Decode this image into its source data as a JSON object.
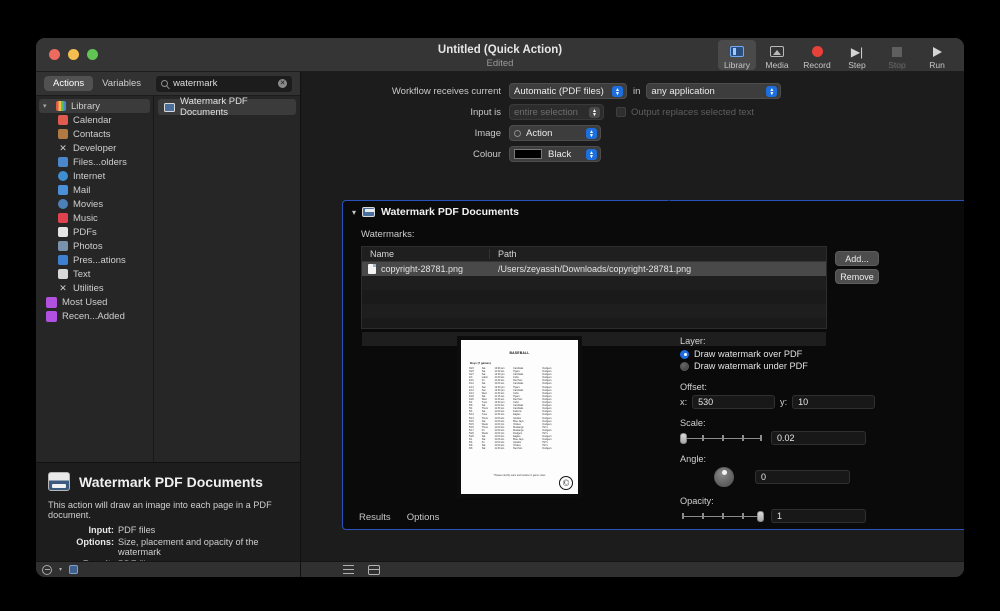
{
  "window": {
    "title": "Untitled (Quick Action)",
    "subtitle": "Edited"
  },
  "toolbar": {
    "items": [
      {
        "label": "Library",
        "icon": "library-icon",
        "active": true,
        "enabled": true
      },
      {
        "label": "Media",
        "icon": "media-icon",
        "active": false,
        "enabled": true
      },
      {
        "label": "Record",
        "icon": "record-icon",
        "active": false,
        "enabled": true
      },
      {
        "label": "Step",
        "icon": "step-icon",
        "active": false,
        "enabled": true
      },
      {
        "label": "Stop",
        "icon": "stop-icon",
        "active": false,
        "enabled": false
      },
      {
        "label": "Run",
        "icon": "run-icon",
        "active": false,
        "enabled": true
      }
    ]
  },
  "left_panel": {
    "segments": [
      {
        "label": "Actions",
        "selected": true
      },
      {
        "label": "Variables",
        "selected": false
      }
    ],
    "search": {
      "value": "watermark",
      "placeholder": "Search",
      "icon": "search-icon",
      "clear_icon": "clear-icon"
    },
    "library": {
      "root": {
        "label": "Library",
        "icon": "library-folder-icon",
        "expanded": true
      },
      "items": [
        {
          "label": "Calendar",
          "color": "#e05a4d"
        },
        {
          "label": "Contacts",
          "color": "#b27a43"
        },
        {
          "label": "Developer",
          "color": "#9e9e9e"
        },
        {
          "label": "Files...olders",
          "color": "#4b86c9"
        },
        {
          "label": "Internet",
          "color": "#3f8fd0"
        },
        {
          "label": "Mail",
          "color": "#4a8fd8"
        },
        {
          "label": "Movies",
          "color": "#4d7fb8"
        },
        {
          "label": "Music",
          "color": "#e0434f"
        },
        {
          "label": "PDFs",
          "color": "#e4e4e4"
        },
        {
          "label": "Photos",
          "color": "#7a93ad"
        },
        {
          "label": "Pres...ations",
          "color": "#3d7fd0"
        },
        {
          "label": "Text",
          "color": "#d8d8d8"
        },
        {
          "label": "Utilities",
          "color": "#9e9e9e"
        }
      ],
      "groups": [
        {
          "label": "Most Used",
          "color": "#b250e0"
        },
        {
          "label": "Recen...Added",
          "color": "#b250e0"
        }
      ]
    },
    "results": [
      {
        "label": "Watermark PDF Documents",
        "icon": "action-icon",
        "selected": true
      }
    ],
    "info": {
      "title": "Watermark PDF Documents",
      "description": "This action will draw an image into each page in a PDF document.",
      "rows": [
        {
          "key": "Input:",
          "value": "PDF files"
        },
        {
          "key": "Options:",
          "value": "Size, placement and opacity of the watermark"
        },
        {
          "key": "Result:",
          "value": "PDF files"
        }
      ]
    },
    "footer": {
      "gear_icon": "gear-icon",
      "caret_icon": "chevron-down-icon",
      "panel_icon": "panel-toggle-icon"
    }
  },
  "workflow": {
    "rows": [
      {
        "label": "Workflow receives current",
        "value": "Automatic (PDF files)",
        "enabled": true,
        "suffix_label": "in",
        "suffix_value": "any application",
        "suffix_enabled": true
      },
      {
        "label": "Input is",
        "value": "entire selection",
        "enabled": false,
        "checkbox_label": "Output replaces selected text",
        "checkbox_checked": false
      },
      {
        "label": "Image",
        "value": "Action",
        "enabled": true
      },
      {
        "label": "Colour",
        "value": "Black",
        "enabled": true,
        "swatch": "#000000"
      }
    ]
  },
  "action_card": {
    "title": "Watermark PDF Documents",
    "icon": "action-icon",
    "disclosure_icon": "chevron-down-icon",
    "close_icon": "close-icon",
    "watermarks_label": "Watermarks:",
    "table": {
      "columns": [
        "Name",
        "Path"
      ],
      "rows": [
        {
          "name": "copyright-28781.png",
          "path": "/Users/zeyassh/Downloads/copyright-28781.png",
          "selected": true
        }
      ],
      "empty_rows": 5
    },
    "buttons": [
      {
        "label": "Add...",
        "name": "add-button"
      },
      {
        "label": "Remove",
        "name": "remove-button"
      }
    ],
    "controls": {
      "layer_label": "Layer:",
      "layer_options": [
        {
          "label": "Draw watermark over PDF",
          "selected": true
        },
        {
          "label": "Draw watermark under PDF",
          "selected": false
        }
      ],
      "offset_label": "Offset:",
      "offset_x_key": "x:",
      "offset_x": "530",
      "offset_y_key": "y:",
      "offset_y": "10",
      "scale_label": "Scale:",
      "scale_value": "0.02",
      "scale_percent": 2,
      "angle_label": "Angle:",
      "angle_value": "0",
      "opacity_label": "Opacity:",
      "opacity_value": "1",
      "opacity_percent": 92
    },
    "tabs": [
      {
        "label": "Results",
        "selected": false
      },
      {
        "label": "Options",
        "selected": false
      }
    ],
    "accent_color": "#2a52be"
  },
  "preview": {
    "title": "BASEBALL",
    "section": "Boys (7 games)",
    "footer": "*Please identify team and location in game notes",
    "watermark_glyph": "©",
    "rows": [
      [
        "3/23",
        "Sat",
        "10:00 am",
        "Cardinals",
        "Dodgers"
      ],
      [
        "3/23",
        "Sat",
        "11:30 am",
        "Tigers",
        "Dodgers"
      ],
      [
        "3/27",
        "Sat",
        "12:00 pm",
        "Cardinals",
        "Dodgers"
      ],
      [
        "4/3",
        "Labor",
        "11:30 am",
        "Cubs",
        "Dodgers"
      ],
      [
        "4/10",
        "Fri",
        "11:30 am",
        "Red Sox",
        "Dodgers"
      ],
      [
        "4/12",
        "Sat",
        "11:00 am",
        "Cardinals",
        "Dodgers"
      ],
      [
        "4/13",
        "Sun",
        "12:30 pm",
        "Tigers",
        "Dodgers"
      ],
      [
        "4/13",
        "Sun",
        "12:30 pm",
        "Cardinals",
        "Dodgers"
      ],
      [
        "4/13",
        "Wed",
        "11:30 am",
        "Cubs",
        "Dodgers"
      ],
      [
        "4/18",
        "Sat",
        "11:15 am",
        "Tigers",
        "Dodgers"
      ],
      [
        "4/20",
        "Wed",
        "11:30 am",
        "Red Sox",
        "Dodgers"
      ],
      [
        "5/4",
        "Tues",
        "12:30 pm",
        "Cubs",
        "Dodgers"
      ],
      [
        "5/8",
        "Sat",
        "11:00 am",
        "Cardinals",
        "Dodgers"
      ],
      [
        "5/4",
        "Thurs",
        "11:30 am",
        "Cardinals",
        "Dodgers"
      ],
      [
        "5/6",
        "Sat",
        "11:00 am",
        "Falcons",
        "Dodgers"
      ],
      [
        "5/13",
        "Tues",
        "11:30 am",
        "Eagles",
        "Dodgers"
      ],
      [
        "5/13",
        "Thurs",
        "11:00 am",
        "Apollos",
        "Dodgers"
      ],
      [
        "5/15",
        "Sat",
        "11:00 am",
        "Blue Jays",
        "Dodgers"
      ],
      [
        "5/15",
        "Weds",
        "11:00 pm",
        "Orioles",
        "Dodgers"
      ],
      [
        "5/15",
        "Thurs",
        "11:00 am",
        "Mustangs",
        "Pirt's"
      ],
      [
        "5/17",
        "Fri",
        "11:00 am",
        "Mustangs",
        "Dodgers"
      ],
      [
        "5/29",
        "Weds",
        "11:00 pm",
        "Dodgers",
        "Pirt's"
      ],
      [
        "5/29",
        "Sat",
        "11:00 am",
        "Eagles",
        "Dodgers"
      ],
      [
        "6/1",
        "Sat",
        "11:00 am",
        "Blue Jays",
        "Dodgers"
      ],
      [
        "6/6",
        "Fri",
        "11:00 am",
        "Apollos",
        "Pirt's"
      ],
      [
        "6/8",
        "Sat",
        "11:00 am",
        "Orioles",
        "Pirt's"
      ],
      [
        "6/8",
        "Sat",
        "11:30 am",
        "Red Sox",
        "Dodgers"
      ]
    ]
  },
  "footer": {
    "list_icon": "list-view-icon",
    "split_icon": "split-view-icon"
  }
}
